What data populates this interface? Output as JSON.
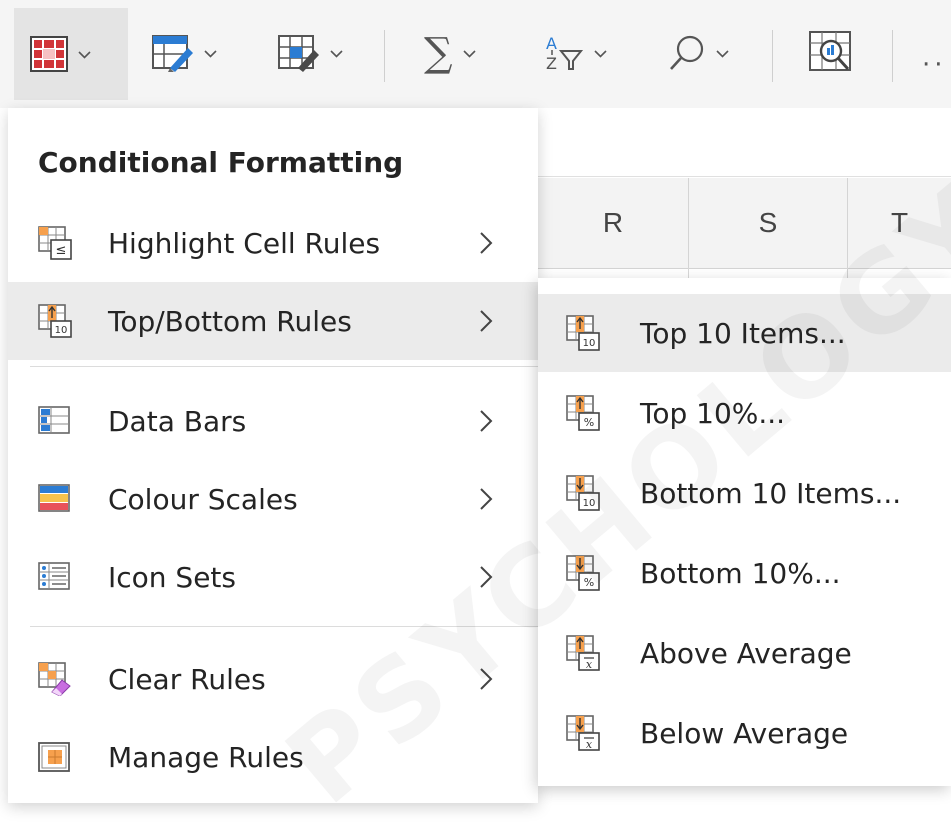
{
  "ribbon": {
    "buttons": [
      {
        "name": "conditional-formatting-icon"
      },
      {
        "name": "format-as-table-icon"
      },
      {
        "name": "cell-styles-icon"
      },
      {
        "name": "autosum-icon"
      },
      {
        "name": "sort-filter-icon"
      },
      {
        "name": "find-select-icon"
      },
      {
        "name": "analyze-data-icon"
      }
    ],
    "more_label": "··"
  },
  "sheet": {
    "columns": [
      "R",
      "S",
      "T"
    ]
  },
  "menu": {
    "title": "Conditional Formatting",
    "items": [
      {
        "label": "Highlight Cell Rules",
        "icon": "highlight-cell-rules-icon",
        "has_submenu": true
      },
      {
        "label": "Top/Bottom Rules",
        "icon": "top-bottom-rules-icon",
        "has_submenu": true,
        "hover": true
      },
      {
        "label": "Data Bars",
        "icon": "data-bars-icon",
        "has_submenu": true
      },
      {
        "label": "Colour Scales",
        "icon": "colour-scales-icon",
        "has_submenu": true
      },
      {
        "label": "Icon Sets",
        "icon": "icon-sets-icon",
        "has_submenu": true
      },
      {
        "label": "Clear Rules",
        "icon": "clear-rules-icon",
        "has_submenu": true
      },
      {
        "label": "Manage Rules",
        "icon": "manage-rules-icon",
        "has_submenu": false
      }
    ]
  },
  "submenu": {
    "items": [
      {
        "label": "Top 10 Items...",
        "icon": "top-10-items-icon",
        "hover": true
      },
      {
        "label": "Top 10%...",
        "icon": "top-10-percent-icon"
      },
      {
        "label": "Bottom 10 Items...",
        "icon": "bottom-10-items-icon"
      },
      {
        "label": "Bottom 10%...",
        "icon": "bottom-10-percent-icon"
      },
      {
        "label": "Above Average",
        "icon": "above-average-icon"
      },
      {
        "label": "Below Average",
        "icon": "below-average-icon"
      }
    ]
  },
  "watermark": "PSYCHOLOGY",
  "colors": {
    "accent_orange": "#f6a04d",
    "icon_red": "#d13438",
    "icon_blue": "#2b7cd3",
    "menu_hover": "#ebebeb"
  }
}
